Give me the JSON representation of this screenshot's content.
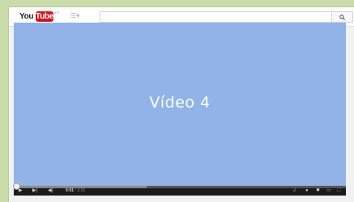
{
  "logo": {
    "you": "You",
    "tube": "Tube",
    "region": "ES"
  },
  "header": {
    "guide_icon": "guide-menu-icon",
    "search_placeholder": "",
    "search_icon": "search-icon"
  },
  "player": {
    "title": "Vídeo 4",
    "background": "#91b3e8",
    "progress_fraction": 0.0,
    "buffered_fraction": 0.4,
    "time_current": "0:01",
    "time_sep": " / ",
    "time_total": "2:15",
    "icons": [
      "play-icon",
      "next-icon",
      "volume-icon",
      "playlist-icon",
      "annotations-icon",
      "settings-icon",
      "size-icon",
      "fullscreen-icon"
    ]
  },
  "colors": {
    "accent": "#cc181e",
    "page_bg": "#c9dcaa"
  }
}
